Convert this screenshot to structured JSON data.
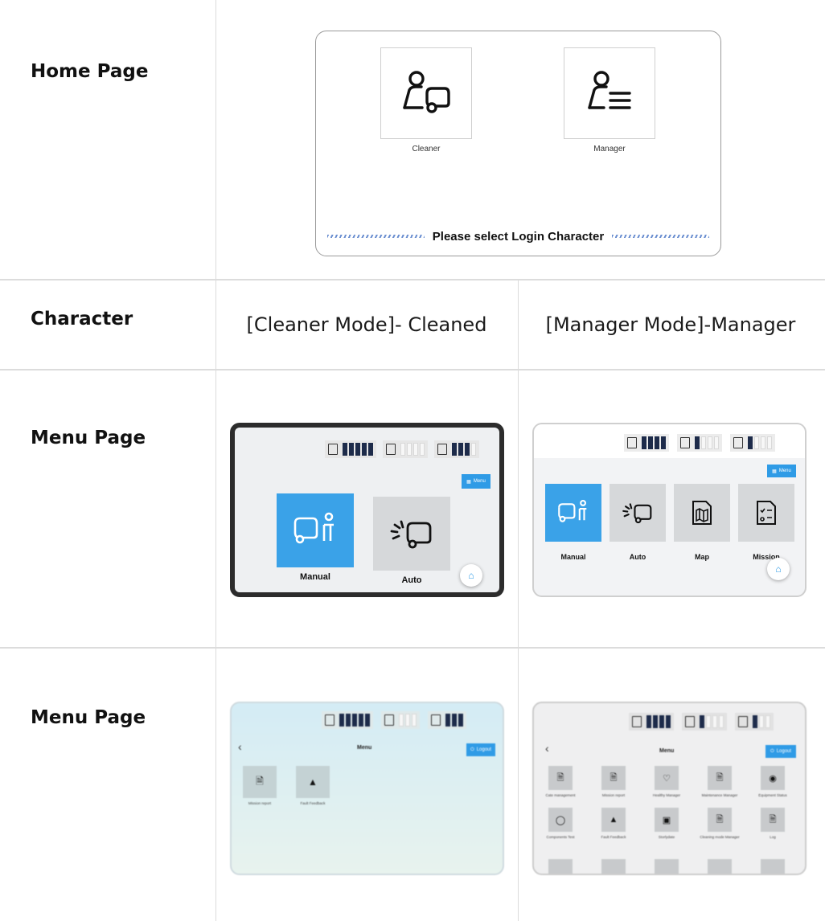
{
  "rows": {
    "home_label": "Home Page",
    "character_label": "Character",
    "menu1_label": "Menu Page",
    "menu2_label": "Menu Page"
  },
  "home": {
    "roles": [
      {
        "label": "Cleaner",
        "icon": "cleaner-person-vehicle-icon"
      },
      {
        "label": "Manager",
        "icon": "manager-person-list-icon"
      }
    ],
    "prompt": "Please select Login Character"
  },
  "character": {
    "cleaner": "[Cleaner Mode]- Cleaned",
    "manager": "[Manager Mode]-Manager"
  },
  "cleaner_menu": {
    "status": [
      {
        "name": "battery",
        "label": "battery",
        "filled": 5,
        "total": 5
      },
      {
        "name": "sewage",
        "label": "sewage",
        "filled": 0,
        "total": 4
      },
      {
        "name": "clean",
        "label": "clean",
        "filled": 3,
        "total": 4
      }
    ],
    "menu_button": "Menu",
    "tiles": [
      {
        "label": "Manual",
        "icon": "manual-driver-icon",
        "active": true
      },
      {
        "label": "Auto",
        "icon": "auto-vehicle-icon",
        "active": false
      }
    ],
    "home_icon": "home-icon"
  },
  "manager_menu": {
    "status": [
      {
        "name": "battery",
        "label": "battery",
        "filled": 4,
        "total": 4
      },
      {
        "name": "sewage",
        "label": "sewage",
        "filled": 1,
        "total": 4
      },
      {
        "name": "clean",
        "label": "clean",
        "filled": 1,
        "total": 4
      }
    ],
    "menu_button": "Menu",
    "tiles": [
      {
        "label": "Manual",
        "icon": "manual-driver-icon",
        "active": true
      },
      {
        "label": "Auto",
        "icon": "auto-vehicle-icon",
        "active": false
      },
      {
        "label": "Map",
        "icon": "map-document-icon",
        "active": false
      },
      {
        "label": "Mission",
        "icon": "mission-checklist-icon",
        "active": false
      }
    ],
    "home_icon": "home-icon"
  },
  "cleaner_submenu": {
    "title": "Menu",
    "logout": "Logout",
    "items": [
      "Mission report",
      "Fault Feedback"
    ]
  },
  "manager_submenu": {
    "title": "Menu",
    "logout": "Logout",
    "items": [
      "Cate management",
      "Mission report",
      "Healthy Manager",
      "Maintenance Manager",
      "Equipment Status",
      "Components Test",
      "Fault Feedback",
      "Storlydate",
      "Cleaning mode Manager",
      "Log"
    ]
  },
  "colors": {
    "accent": "#3aa2e8",
    "tile_idle": "#d6d8da",
    "bar_fill": "#1d2b4a",
    "grid": "#dcdcdc"
  }
}
